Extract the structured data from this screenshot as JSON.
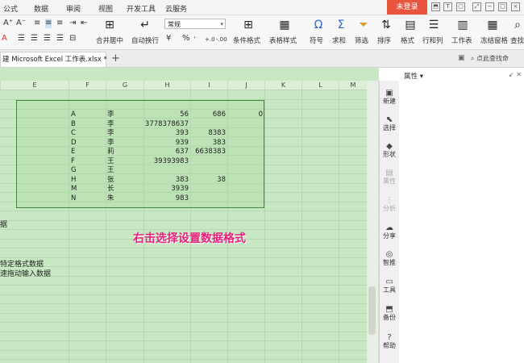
{
  "menubar": {
    "items": [
      "公式",
      "数据",
      "审阅",
      "视图",
      "开发工具",
      "云服务"
    ],
    "login": "未登录"
  },
  "toolbar": {
    "font_grow": "A⁺",
    "font_shrink": "A⁻",
    "merge_label": "合并居中",
    "wrap_label": "自动换行",
    "number_format": "常规",
    "percent": "%",
    "comma": "·",
    "decimals_add": "+.0",
    "decimals_sub": "-.00",
    "tools": [
      {
        "label": "条件格式",
        "icon": "⊞"
      },
      {
        "label": "表格样式",
        "icon": "▦"
      },
      {
        "label": "符号",
        "icon": "Ω"
      },
      {
        "label": "求和",
        "icon": "Σ"
      },
      {
        "label": "筛选",
        "icon": "⏷"
      },
      {
        "label": "排序",
        "icon": "⇅"
      },
      {
        "label": "格式",
        "icon": "▤"
      },
      {
        "label": "行和列",
        "icon": "☰"
      },
      {
        "label": "工作表",
        "icon": "▥"
      },
      {
        "label": "冻结窗格",
        "icon": "▦"
      },
      {
        "label": "查找",
        "icon": "⌕"
      }
    ]
  },
  "tabbar": {
    "doc_tab": "建 Microsoft Excel 工作表.xlsx *",
    "add": "+",
    "search": "点此查找命"
  },
  "sheet": {
    "columns": [
      "E",
      "F",
      "G",
      "H",
      "I",
      "J",
      "K",
      "L",
      "M"
    ],
    "rows": [
      {
        "f": "A",
        "g": "李",
        "h": "56",
        "i": "686",
        "j": "0"
      },
      {
        "f": "B",
        "g": "李",
        "h": "3778378637",
        "i": "",
        "j": ""
      },
      {
        "f": "C",
        "g": "李",
        "h": "393",
        "i": "8383",
        "j": ""
      },
      {
        "f": "D",
        "g": "李",
        "h": "939",
        "i": "383",
        "j": ""
      },
      {
        "f": "E",
        "g": "莉",
        "h": "637",
        "i": "6638383",
        "j": ""
      },
      {
        "f": "F",
        "g": "王",
        "h": "39393983",
        "i": "",
        "j": ""
      },
      {
        "f": "G",
        "g": "王",
        "h": "",
        "i": "",
        "j": ""
      },
      {
        "f": "H",
        "g": "张",
        "h": "383",
        "i": "38",
        "j": ""
      },
      {
        "f": "M",
        "g": "长",
        "h": "3939",
        "i": "",
        "j": ""
      },
      {
        "f": "N",
        "g": "朱",
        "h": "983",
        "i": "",
        "j": ""
      }
    ],
    "instruction": "右击选择设置数据格式",
    "side_texts": [
      "据",
      "特定格式数据",
      "速拖动输入数据"
    ]
  },
  "taskpane": {
    "items": [
      {
        "label": "新建",
        "icon": "▣",
        "dim": false
      },
      {
        "label": "选择",
        "icon": "⬉",
        "dim": false
      },
      {
        "label": "形状",
        "icon": "◆",
        "dim": false
      },
      {
        "label": "属性",
        "icon": "▤",
        "dim": true
      },
      {
        "label": "分析",
        "icon": "⋮",
        "dim": true
      },
      {
        "label": "分享",
        "icon": "☁",
        "dim": false
      },
      {
        "label": "智推",
        "icon": "◎",
        "dim": false
      },
      {
        "label": "工具",
        "icon": "▭",
        "dim": false
      },
      {
        "label": "备份",
        "icon": "⬒",
        "dim": false
      },
      {
        "label": "帮助",
        "icon": "?",
        "dim": false
      }
    ]
  },
  "props": {
    "title": "属性 ▾",
    "icons": "↙ ✕"
  },
  "colors": {
    "accent": "#e8553e",
    "sheet_bg": "#c8e8c4",
    "selection_border": "#3d8a38",
    "instruction": "#e8207a"
  }
}
